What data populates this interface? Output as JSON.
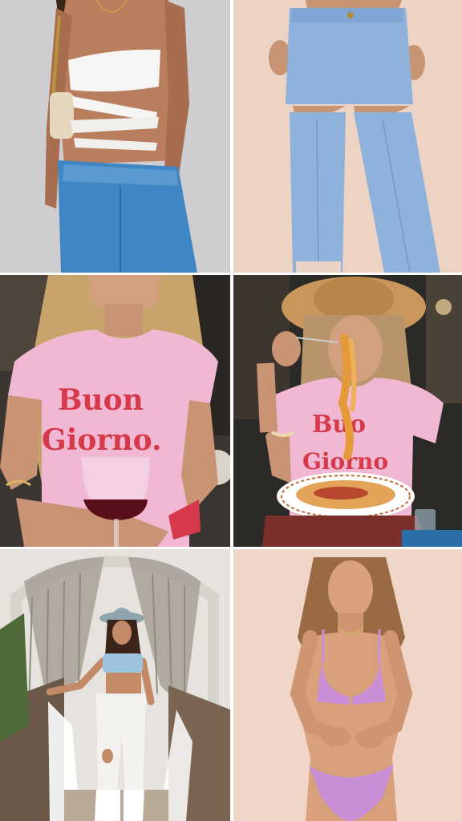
{
  "collage": {
    "tiles": [
      {
        "subject": "white wrap top with blue jeans",
        "bg": "#c9c9cb"
      },
      {
        "subject": "cut-out knee light blue jeans",
        "bg": "#edd3c4"
      },
      {
        "subject": "pink t-shirt with wine glass",
        "bg": "#3a3530"
      },
      {
        "subject": "pink t-shirt eating spaghetti",
        "bg": "#2c2a26"
      },
      {
        "subject": "denim bandeau and white ripped jeans",
        "bg": "#e6e3df"
      },
      {
        "subject": "lilac bikini",
        "bg": "#efd6c8"
      }
    ],
    "shirt_print_1": {
      "line1": "Buon",
      "line2": "Giorno."
    },
    "shirt_print_2": {
      "line1": "Buo",
      "line2": "Giorno"
    }
  },
  "colors": {
    "denim": "#6b97c9",
    "light_denim": "#8eb2dc",
    "pink_shirt": "#f1b8d3",
    "print_red": "#d63a4a",
    "lilac": "#c98fd6",
    "skin": "#c98d6a"
  }
}
